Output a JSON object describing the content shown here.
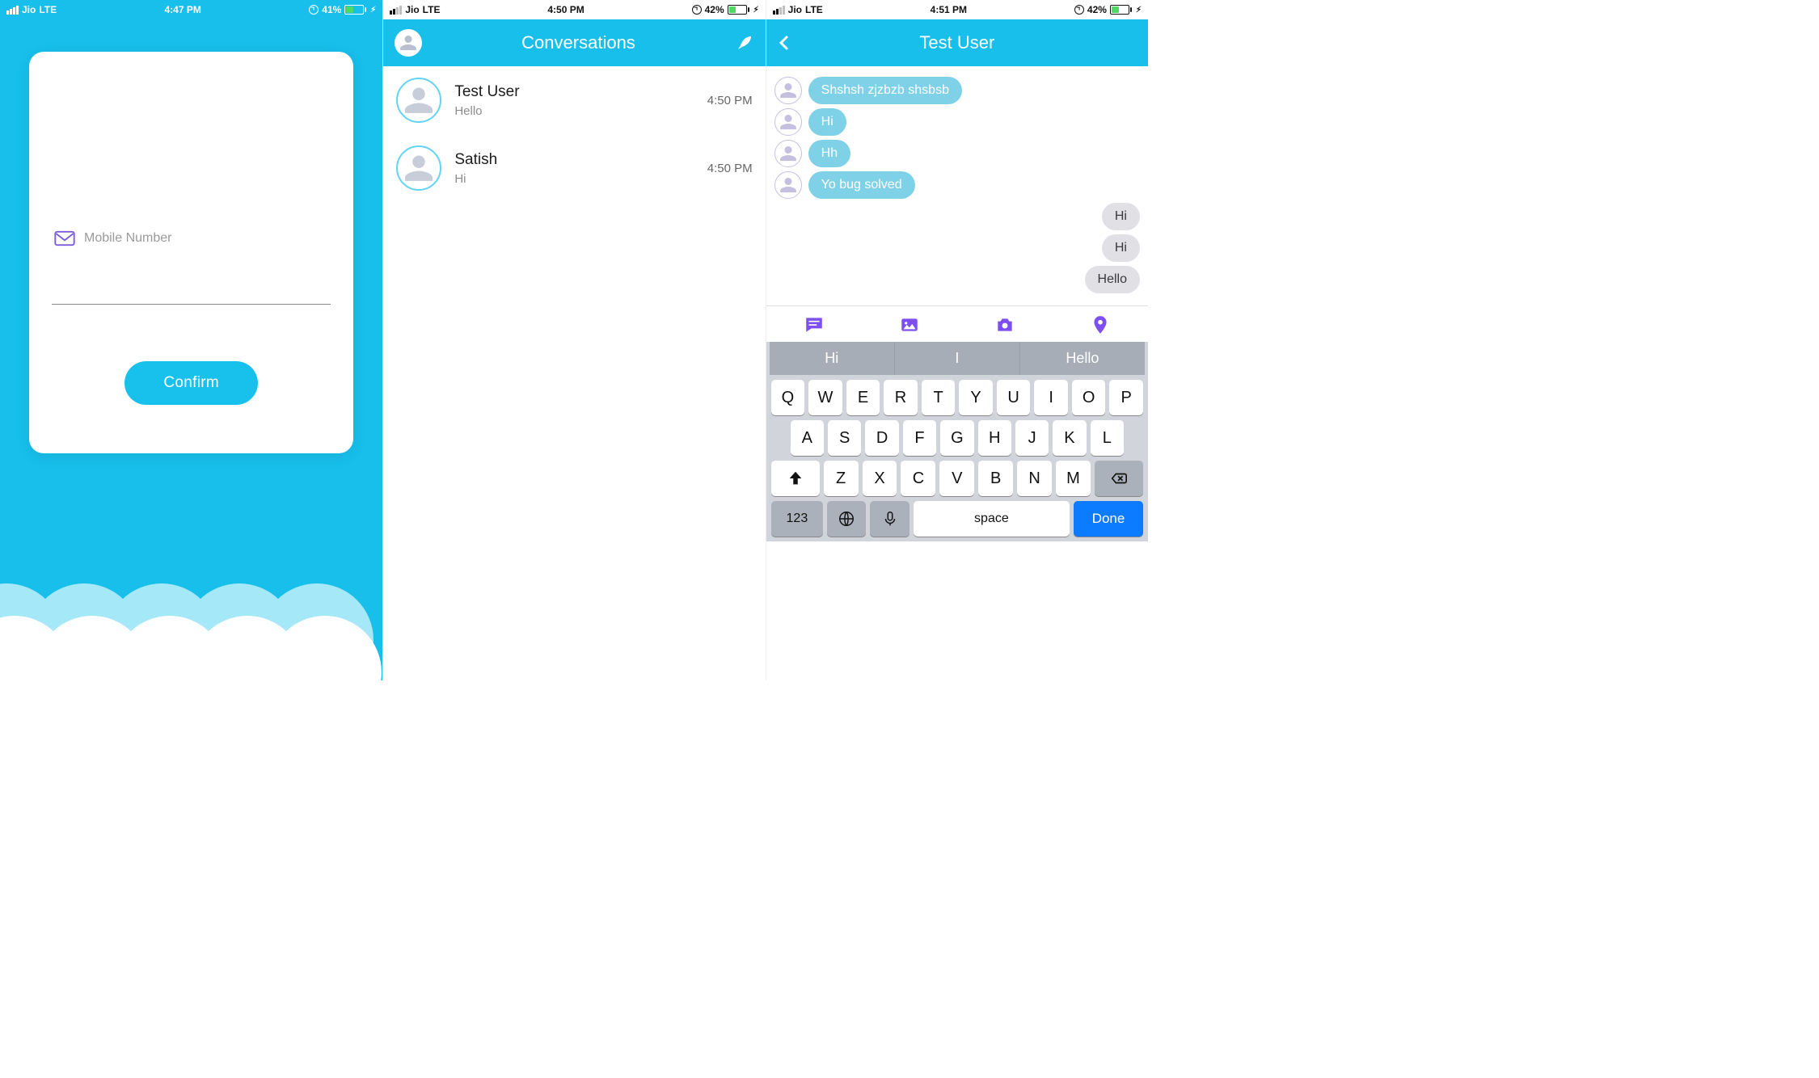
{
  "s1": {
    "status": {
      "carrier": "Jio",
      "net": "LTE",
      "time": "4:47 PM",
      "battery_pct": "41%"
    },
    "mobile_placeholder": "Mobile Number",
    "confirm_label": "Confirm"
  },
  "s2": {
    "status": {
      "carrier": "Jio",
      "net": "LTE",
      "time": "4:50 PM",
      "battery_pct": "42%"
    },
    "title": "Conversations",
    "items": [
      {
        "name": "Test User",
        "preview": "Hello",
        "time": "4:50 PM"
      },
      {
        "name": "Satish",
        "preview": "Hi",
        "time": "4:50 PM"
      }
    ]
  },
  "s3": {
    "status": {
      "carrier": "Jio",
      "net": "LTE",
      "time": "4:51 PM",
      "battery_pct": "42%"
    },
    "title": "Test User",
    "messages": [
      {
        "dir": "in",
        "text": "Shshsh zjzbzb shsbsb"
      },
      {
        "dir": "in",
        "text": "Hi"
      },
      {
        "dir": "in",
        "text": "Hh"
      },
      {
        "dir": "in",
        "text": "Yo bug solved"
      },
      {
        "dir": "out",
        "text": "Hi"
      },
      {
        "dir": "out",
        "text": "Hi"
      },
      {
        "dir": "out",
        "text": "Hello"
      }
    ],
    "suggestions": [
      "Hi",
      "I",
      "Hello"
    ],
    "keyboard": {
      "row1": [
        "Q",
        "W",
        "E",
        "R",
        "T",
        "Y",
        "U",
        "I",
        "O",
        "P"
      ],
      "row2": [
        "A",
        "S",
        "D",
        "F",
        "G",
        "H",
        "J",
        "K",
        "L"
      ],
      "row3": [
        "Z",
        "X",
        "C",
        "V",
        "B",
        "N",
        "M"
      ],
      "sym": "123",
      "space": "space",
      "done": "Done"
    }
  }
}
